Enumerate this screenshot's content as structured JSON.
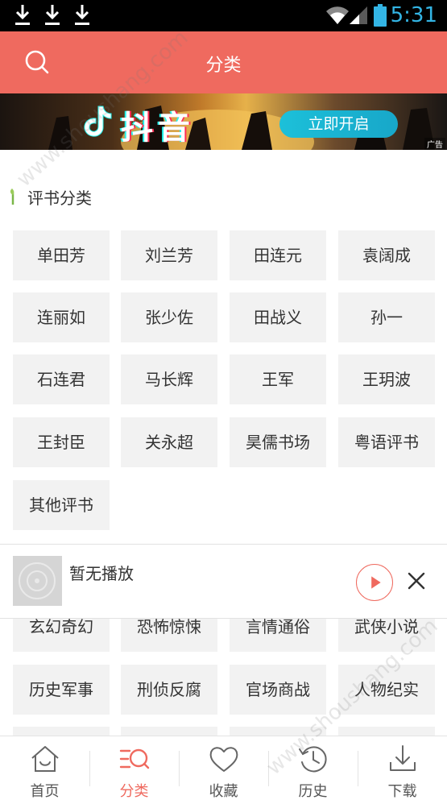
{
  "status_bar": {
    "time": "5:31"
  },
  "header": {
    "title": "分类"
  },
  "banner": {
    "brand": "抖音",
    "cta": "立即开启",
    "ad_label": "广告"
  },
  "section": {
    "title": "评书分类",
    "tags": [
      "单田芳",
      "刘兰芳",
      "田连元",
      "袁阔成",
      "连丽如",
      "张少佐",
      "田战义",
      "孙一",
      "石连君",
      "马长辉",
      "王军",
      "王玥波",
      "王封臣",
      "关永超",
      "昊儒书场",
      "粤语评书",
      "其他评书"
    ]
  },
  "section2": {
    "tags": [
      "玄幻奇幻",
      "恐怖惊悚",
      "言情通俗",
      "武侠小说",
      "历史军事",
      "刑侦反腐",
      "官场商战",
      "人物纪实"
    ]
  },
  "player": {
    "status": "暂无播放"
  },
  "bottom_nav": [
    {
      "label": "首页"
    },
    {
      "label": "分类"
    },
    {
      "label": "收藏"
    },
    {
      "label": "历史"
    },
    {
      "label": "下载"
    }
  ],
  "watermark": "www.shoushang.com",
  "colors": {
    "accent": "#ef6a5f",
    "status_icon": "#33b5e5"
  }
}
